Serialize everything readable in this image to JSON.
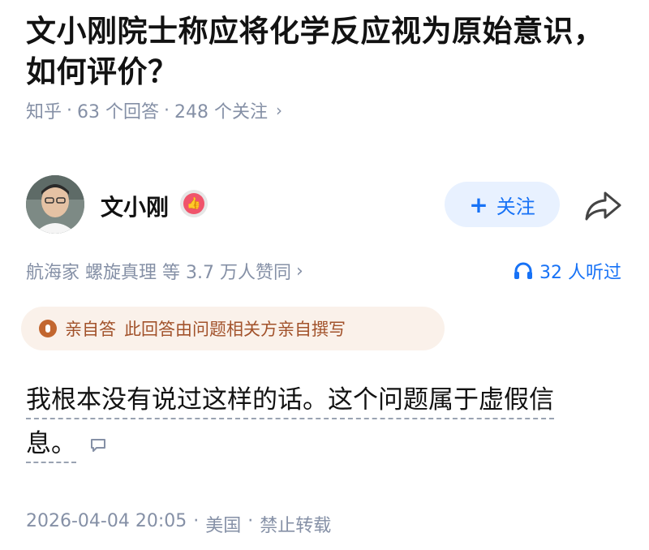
{
  "question": {
    "title_line1": "文小刚院士称应将化学反应视为原始意识，",
    "title_line2": "如何评价？",
    "source": "知乎",
    "answers": "63 个回答",
    "followers": "248 个关注"
  },
  "author": {
    "name": "文小刚",
    "follow_label": "关注"
  },
  "stats": {
    "upvotes": "航海家 螺旋真理 等 3.7 万人赞同",
    "listens": "32 人听过"
  },
  "self_answer": {
    "label": "亲自答",
    "description": "此回答由问题相关方亲自撰写"
  },
  "answer": {
    "line1": "我根本没有说过这样的话。这个问题属于虚假信",
    "line2": "息。"
  },
  "footer": {
    "datetime": "2026-04-04 20:05",
    "location": "美国",
    "copyright": "禁止转载"
  },
  "colors": {
    "accent": "#1772f6",
    "meta": "#8590a6",
    "tag_text": "#a2522b",
    "tag_bg": "#faf1ea"
  },
  "icons": [
    "chevron-right-icon",
    "verified-badge-icon",
    "plus-icon",
    "share-icon",
    "headphones-icon",
    "microphone-icon",
    "comment-icon"
  ]
}
